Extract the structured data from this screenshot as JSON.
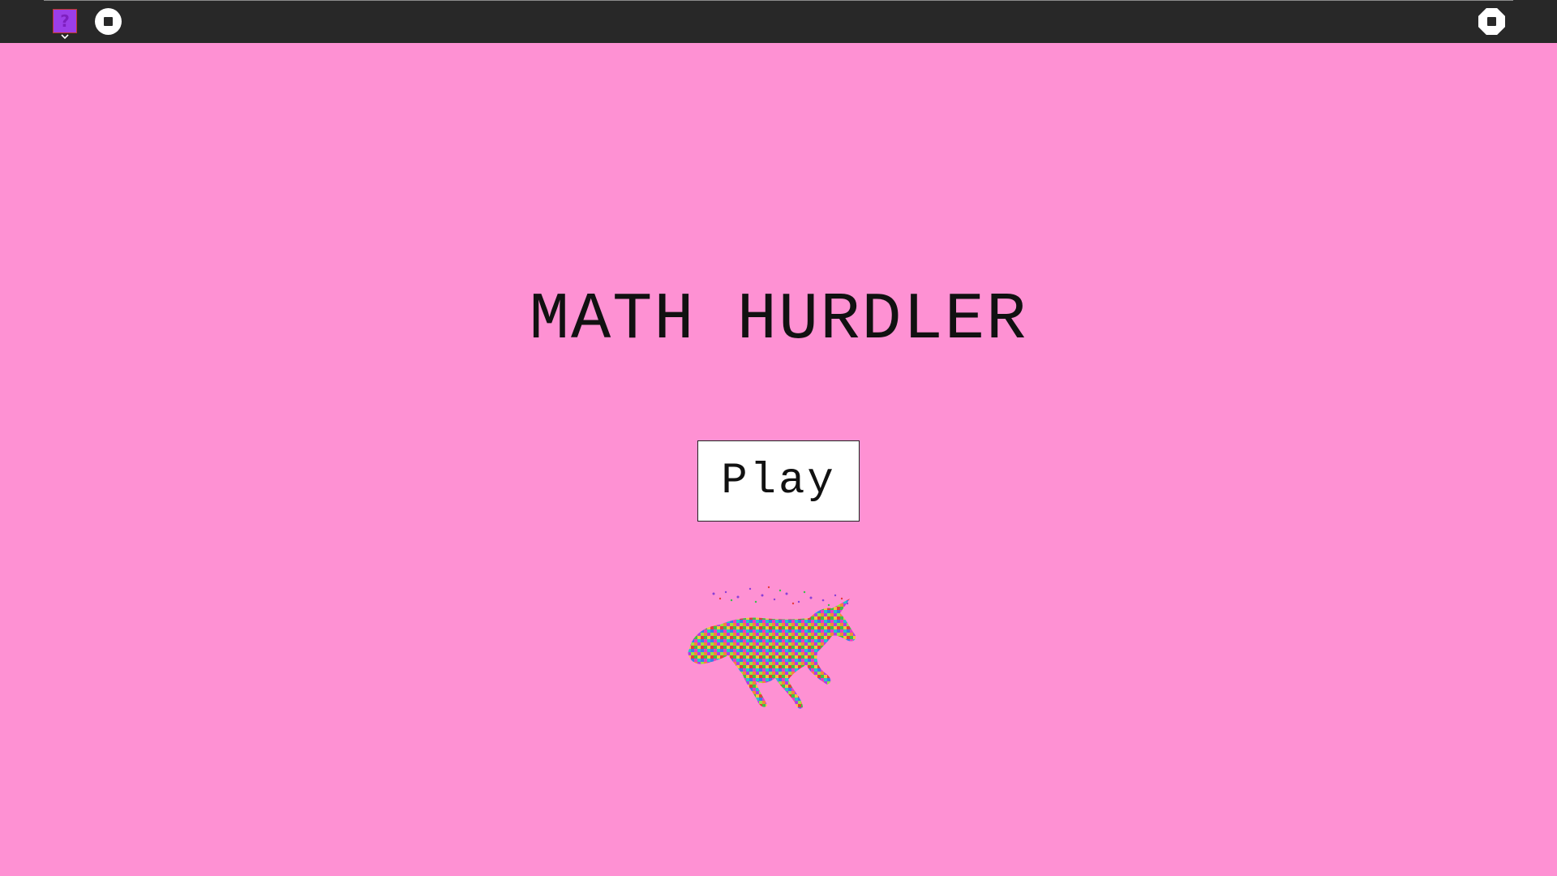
{
  "toolbar": {
    "menu_icon_glyph": "?",
    "menu_icon": "question-block-icon",
    "menu_chevron_icon": "chevron-down-icon",
    "left_stop_icon": "stop-icon",
    "right_stop_icon": "stop-sign-icon",
    "background": "#282828"
  },
  "game": {
    "title": "MATH HURDLER",
    "play_label": "Play",
    "background": "#fe91d3",
    "mascot_icon": "rainbow-unicorn-icon"
  }
}
